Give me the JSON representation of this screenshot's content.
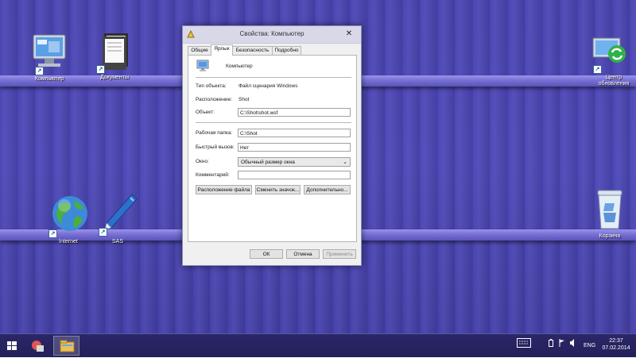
{
  "desktop": {
    "icons": [
      {
        "label": "Компьютер",
        "icon": "computer-icon"
      },
      {
        "label": "Документы",
        "icon": "documents-icon"
      },
      {
        "label": "Центр обновления",
        "icon": "update-center-icon"
      },
      {
        "label": "Internet",
        "icon": "internet-globe-icon"
      },
      {
        "label": "SAS",
        "icon": "sas-pen-icon"
      },
      {
        "label": "Корзина",
        "icon": "recycle-bin-icon"
      }
    ]
  },
  "dialog": {
    "title": "Свойства: Компьютер",
    "close": "✕",
    "tabs": [
      {
        "label": "Общие",
        "active": false
      },
      {
        "label": "Ярлык",
        "active": true
      },
      {
        "label": "Безопасность",
        "active": false
      },
      {
        "label": "Подробно",
        "active": false
      }
    ],
    "shortcut_name": "Компьютер",
    "rows": {
      "type_label": "Тип объекта:",
      "type_value": "Файл сценария Windows",
      "location_label": "Расположение:",
      "location_value": "Shot",
      "target_label": "Объект:",
      "target_value": "C:\\Shot\\shot.wsf",
      "workdir_label": "Рабочая папка:",
      "workdir_value": "C:\\Shot",
      "hotkey_label": "Быстрый вызов:",
      "hotkey_value": "Нет",
      "window_label": "Окно:",
      "window_value": "Обычный размер окна",
      "comment_label": "Комментарий:",
      "comment_value": ""
    },
    "buttons": {
      "open_location": "Расположение файла",
      "change_icon": "Сменить значок...",
      "advanced": "Дополнительно...",
      "ok": "ОК",
      "cancel": "Отмена",
      "apply": "Применить"
    }
  },
  "taskbar": {
    "language": "ENG",
    "time": "22:37",
    "date": "07.02.2014"
  },
  "colors": {
    "wallpaper": "#4b45b3",
    "taskbar": "#2b2768",
    "dialog_bg": "#f0f0f0"
  }
}
